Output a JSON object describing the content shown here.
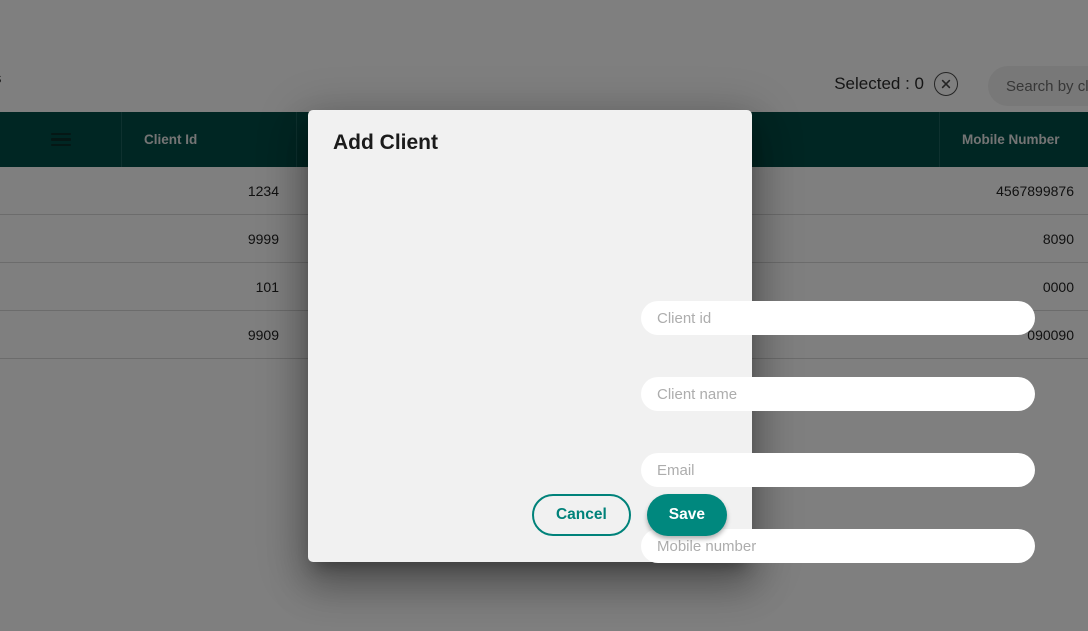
{
  "toolbar": {
    "left_fragment": "s",
    "selected_label": "Selected : 0",
    "clear_icon": "close-circle-icon",
    "search_placeholder": "Search by clie"
  },
  "table": {
    "menu_icon": "hamburger-menu-icon",
    "columns": [
      {
        "key": "menu",
        "label": ""
      },
      {
        "key": "client_id",
        "label": "Client Id"
      },
      {
        "key": "middle",
        "label": ""
      },
      {
        "key": "mobile_number",
        "label": "Mobile Number"
      }
    ],
    "rows": [
      {
        "client_id": "1234",
        "mobile_number": "4567899876"
      },
      {
        "client_id": "9999",
        "mobile_number": "8090"
      },
      {
        "client_id": "101",
        "mobile_number": "0000"
      },
      {
        "client_id": "9909",
        "mobile_number": "090090"
      }
    ]
  },
  "dialog": {
    "title": "Add Client",
    "fields": [
      {
        "name": "client-id-input",
        "placeholder": "Client id",
        "value": ""
      },
      {
        "name": "client-name-input",
        "placeholder": "Client name",
        "value": ""
      },
      {
        "name": "email-input",
        "placeholder": "Email",
        "value": ""
      },
      {
        "name": "mobile-number-input",
        "placeholder": "Mobile number",
        "value": ""
      }
    ],
    "cancel_label": "Cancel",
    "save_label": "Save"
  },
  "colors": {
    "header_teal": "#004d47",
    "accent_teal": "#00887e",
    "cancel_border": "#00827a",
    "dialog_bg": "#f1f1f1",
    "scrim": "rgba(0,0,0,0.5)"
  }
}
